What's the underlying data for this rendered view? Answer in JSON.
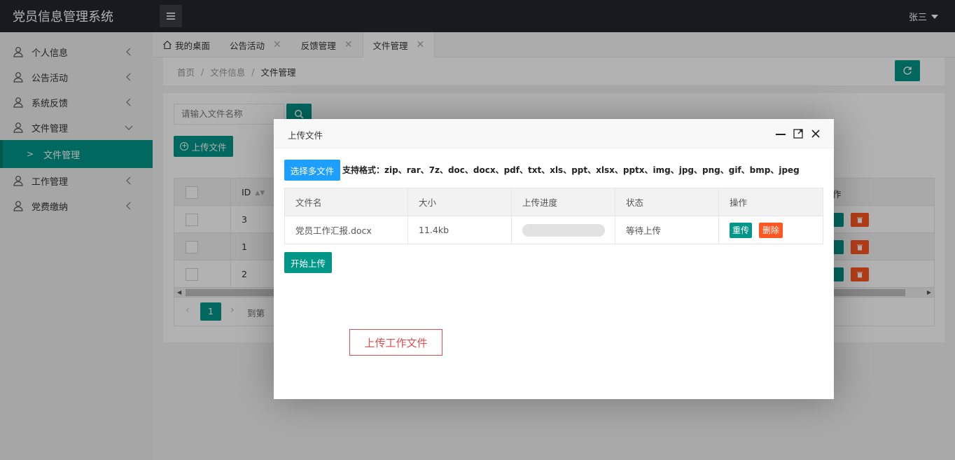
{
  "app": {
    "title": "党员信息管理系统",
    "user": "张三"
  },
  "sidebar": {
    "items": [
      {
        "label": "个人信息"
      },
      {
        "label": "公告活动"
      },
      {
        "label": "系统反馈"
      },
      {
        "label": "文件管理"
      },
      {
        "label": "文件管理",
        "sub": true
      },
      {
        "label": "工作管理"
      },
      {
        "label": "党费缴纳"
      }
    ]
  },
  "tabs": [
    {
      "label": "我的桌面"
    },
    {
      "label": "公告活动"
    },
    {
      "label": "反馈管理"
    },
    {
      "label": "文件管理"
    }
  ],
  "breadcrumb": {
    "home": "首页",
    "parent": "文件信息",
    "current": "文件管理"
  },
  "toolbar": {
    "search_placeholder": "请输入文件名称",
    "upload_label": "上传文件"
  },
  "bg_table": {
    "id_header": "ID",
    "op_header": "作",
    "ids": [
      "3",
      "1",
      "2"
    ]
  },
  "pager": {
    "page": "1",
    "goto": "到第"
  },
  "modal": {
    "title": "上传文件",
    "pick_label": "选择多文件",
    "formats": "支持格式：zip、rar、7z、doc、docx、pdf、txt、xls、ppt、xlsx、pptx、img、jpg、png、gif、bmp、jpeg",
    "columns": [
      "文件名",
      "大小",
      "上传进度",
      "状态",
      "操作"
    ],
    "rows": [
      {
        "name": "党员工作汇报.docx",
        "size": "11.4kb",
        "progress": 0,
        "status": "等待上传",
        "retry": "重传",
        "delete": "删除"
      }
    ],
    "start_label": "开始上传",
    "note": "上传工作文件"
  },
  "colors": {
    "primary": "#009688",
    "blue": "#1E9FFF",
    "danger": "#FF5722",
    "header": "#23262E"
  }
}
